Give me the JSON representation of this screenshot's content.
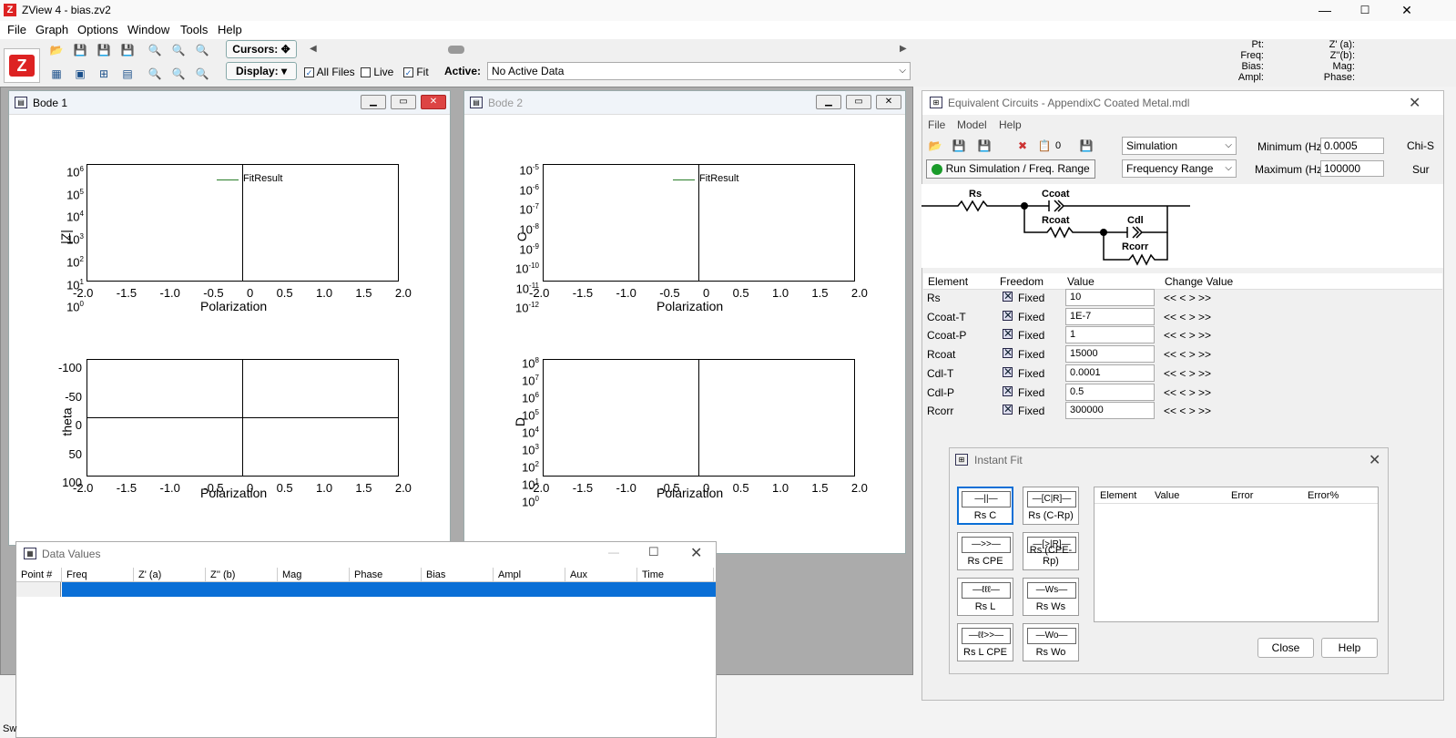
{
  "app": {
    "title": "ZView 4 - bias.zv2",
    "logo": "Z"
  },
  "window_controls": {
    "minimize": "—",
    "maximize": "☐",
    "close": "✕"
  },
  "menu": [
    "File",
    "Graph",
    "Options",
    "Window",
    "Tools",
    "Help"
  ],
  "toolbar": {
    "cursors_label": "Cursors:",
    "display_label": "Display:",
    "all_files_label": "All Files",
    "all_files_checked": true,
    "live_label": "Live",
    "live_checked": false,
    "fit_label": "Fit",
    "fit_checked": true,
    "active_label": "Active:",
    "active_value": "No Active Data"
  },
  "readout": {
    "pt": "Pt:",
    "freq": "Freq:",
    "bias": "Bias:",
    "ampl": "Ampl:",
    "za": "Z' (a):",
    "zb": "Z''(b):",
    "mag": "Mag:",
    "phase": "Phase:"
  },
  "bode1": {
    "title": "Bode 1",
    "legend": "FitResult",
    "top": {
      "yticks_base": "10",
      "yticks_exp": [
        "6",
        "5",
        "4",
        "3",
        "2",
        "1",
        "0"
      ],
      "ylabel": "|Z|",
      "xlabel": "Polarization"
    },
    "bottom": {
      "yticks": [
        "-100",
        "-50",
        "0",
        "50",
        "100"
      ],
      "ylabel": "theta",
      "xlabel": "Polarization"
    }
  },
  "bode2": {
    "title": "Bode 2",
    "legend": "FitResult",
    "top": {
      "yticks_base": "10",
      "yticks_exp": [
        "-5",
        "-6",
        "-7",
        "-8",
        "-9",
        "-10",
        "-11",
        "-12"
      ],
      "ylabel": "C",
      "xlabel": "Polarization"
    },
    "bottom": {
      "yticks_base": "10",
      "yticks_exp": [
        "8",
        "7",
        "6",
        "5",
        "4",
        "3",
        "2",
        "1",
        "0"
      ],
      "ylabel": "D",
      "xlabel": "Polarization"
    }
  },
  "xticks": [
    "-2.0",
    "-1.5",
    "-1.0",
    "-0.5",
    "0",
    "0.5",
    "1.0",
    "1.5",
    "2.0"
  ],
  "equivalent_circuits": {
    "title": "Equivalent Circuits - AppendixC Coated Metal.mdl",
    "menu": [
      "File",
      "Model",
      "Help"
    ],
    "count": "0",
    "run_button": "Run Simulation / Freq. Range",
    "mode": "Simulation",
    "range": "Frequency Range",
    "min_label": "Minimum (Hz)",
    "min_value": "0.0005",
    "max_label": "Maximum (Hz)",
    "max_value": "100000",
    "chi_label": "Chi-S",
    "sum_label": "Sur",
    "circuit_labels": {
      "rs": "Rs",
      "ccoat": "Ccoat",
      "rcoat": "Rcoat",
      "cdl": "Cdl",
      "rcorr": "Rcorr"
    },
    "columns": [
      "Element",
      "Freedom",
      "Value",
      "Change Value"
    ],
    "fixed_text": "Fixed",
    "arrows": "<<  <  >  >>",
    "rows": [
      {
        "element": "Rs",
        "value": "10"
      },
      {
        "element": "Ccoat-T",
        "value": "1E-7"
      },
      {
        "element": "Ccoat-P",
        "value": "1"
      },
      {
        "element": "Rcoat",
        "value": "15000"
      },
      {
        "element": "Cdl-T",
        "value": "0.0001"
      },
      {
        "element": "Cdl-P",
        "value": "0.5"
      },
      {
        "element": "Rcorr",
        "value": "300000"
      }
    ]
  },
  "instant_fit": {
    "title": "Instant Fit",
    "buttons": [
      {
        "label": "Rs  C",
        "sym": "—||—"
      },
      {
        "label": "Rs  (C-Rp)",
        "sym": "—[C|R]—"
      },
      {
        "label": "Rs  CPE",
        "sym": "—>>—"
      },
      {
        "label": "Rs  (CPE-Rp)",
        "sym": "—[>|R]—"
      },
      {
        "label": "Rs  L",
        "sym": "—ℓℓℓ—"
      },
      {
        "label": "Rs  Ws",
        "sym": "—Ws—"
      },
      {
        "label": "Rs  L CPE",
        "sym": "—ℓℓ>>—"
      },
      {
        "label": "Rs  Wo",
        "sym": "—Wo—"
      }
    ],
    "columns": [
      "Element",
      "Value",
      "Error",
      "Error%"
    ],
    "close": "Close",
    "help": "Help"
  },
  "data_values": {
    "title": "Data Values",
    "columns": [
      "Point #",
      "Freq",
      "Z' (a)",
      "Z'' (b)",
      "Mag",
      "Phase",
      "Bias",
      "Ampl",
      "Aux",
      "Time"
    ]
  },
  "status": "Sw"
}
